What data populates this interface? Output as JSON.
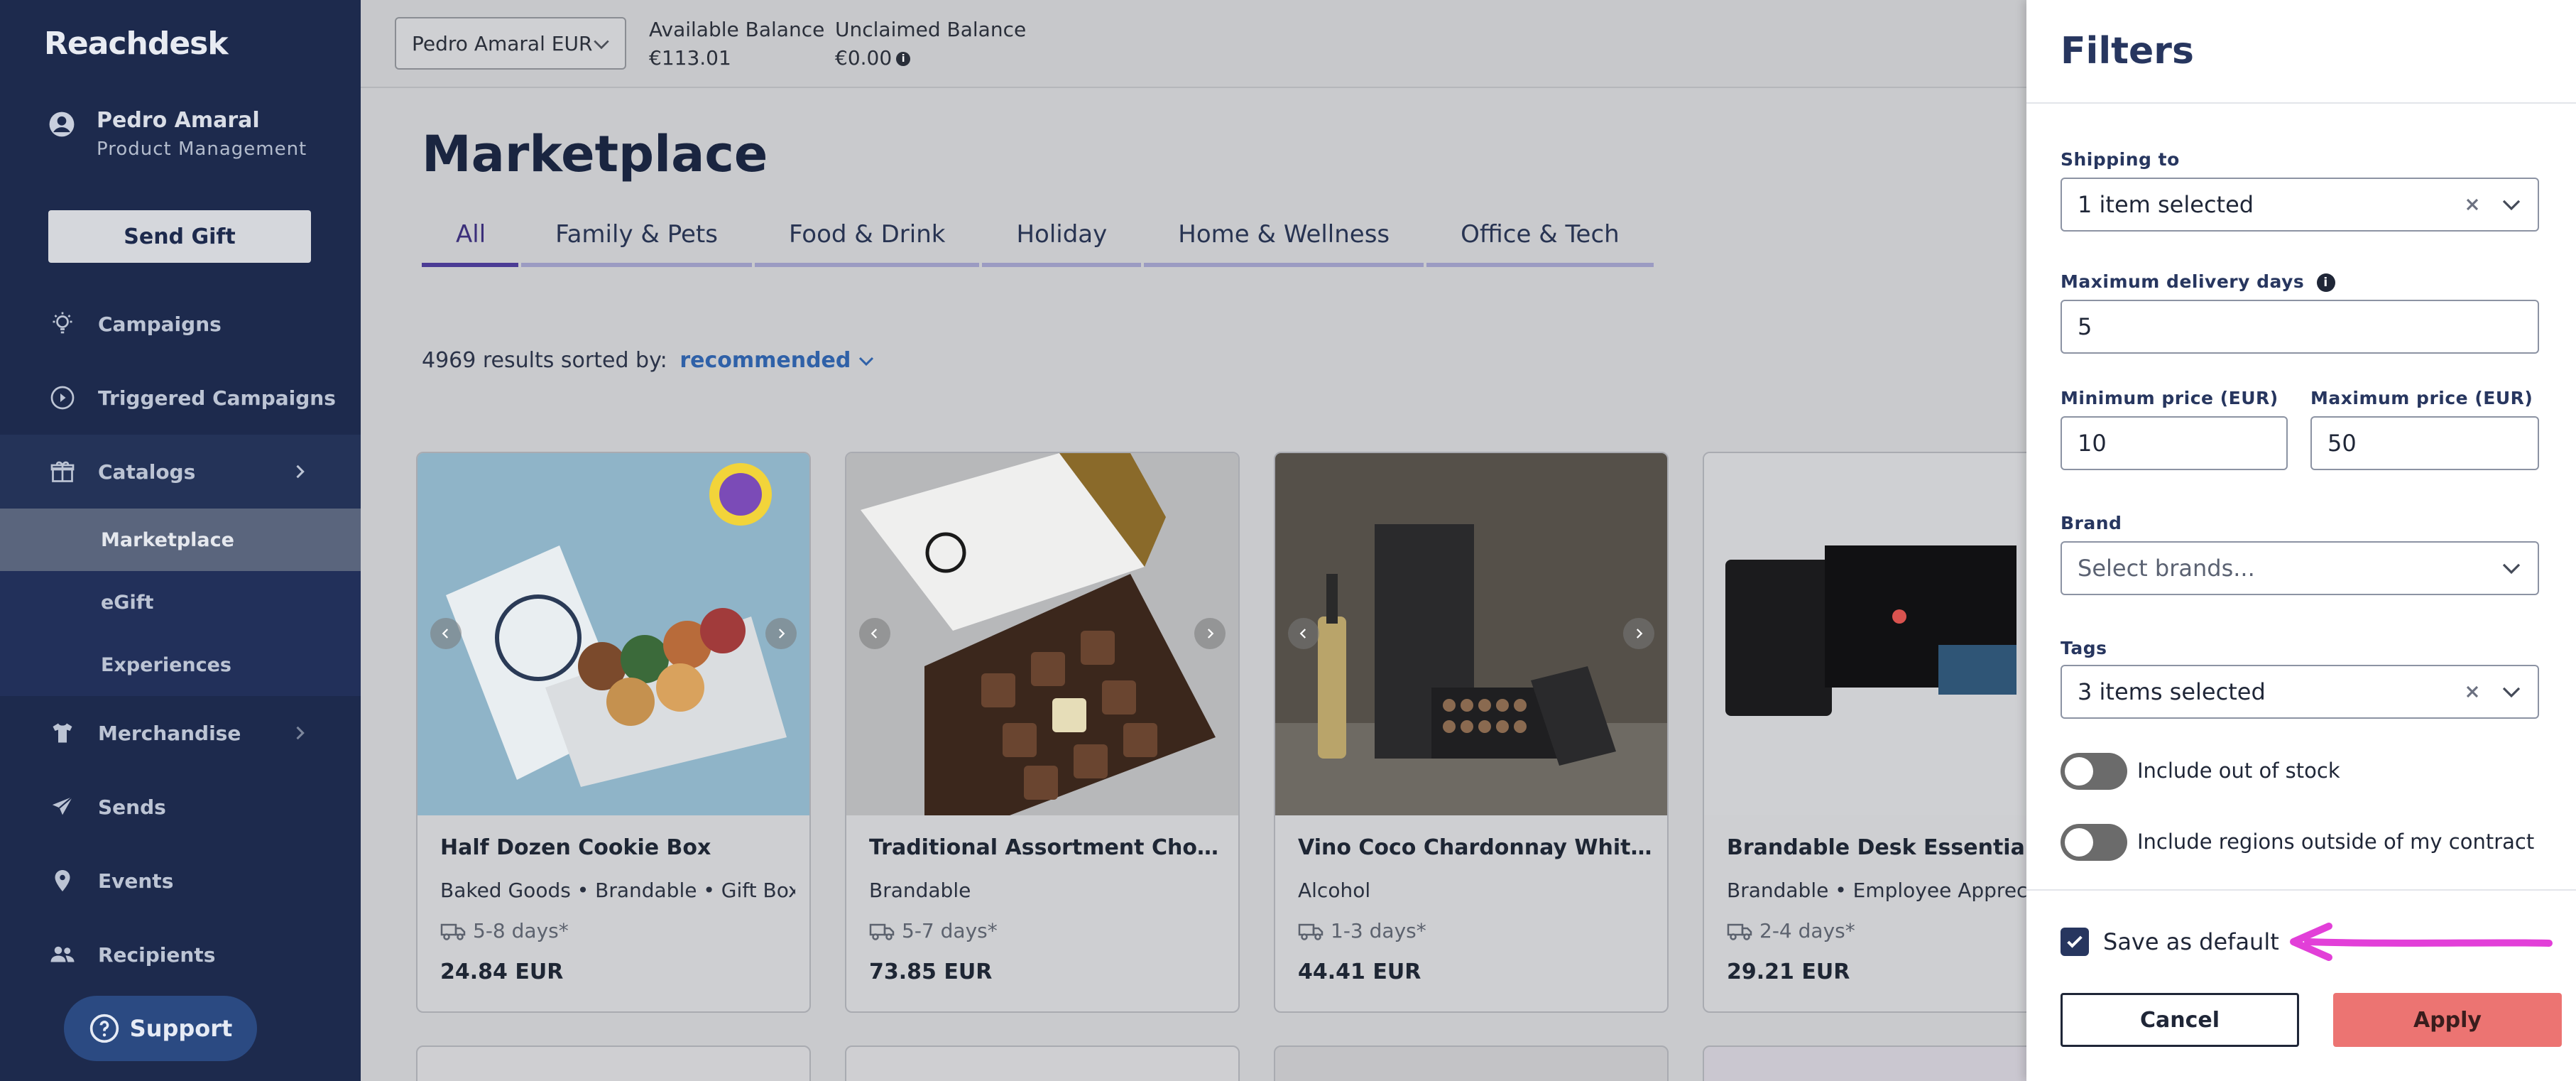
{
  "app": {
    "logo": "Reachdesk"
  },
  "user": {
    "name": "Pedro Amaral",
    "role": "Product Management"
  },
  "sidebar": {
    "send_gift": "Send Gift",
    "items": [
      {
        "label": "Campaigns",
        "icon": "lightbulb-icon"
      },
      {
        "label": "Triggered Campaigns",
        "icon": "play-circle-icon"
      },
      {
        "label": "Catalogs",
        "icon": "gift-icon"
      },
      {
        "label": "Merchandise",
        "icon": "tshirt-icon"
      },
      {
        "label": "Sends",
        "icon": "paper-plane-icon"
      },
      {
        "label": "Events",
        "icon": "map-pin-icon"
      },
      {
        "label": "Recipients",
        "icon": "people-icon"
      }
    ],
    "catalog_sub": [
      "Marketplace",
      "eGift",
      "Experiences"
    ],
    "support": "Support"
  },
  "topbar": {
    "account": "Pedro Amaral EUR",
    "available_label": "Available Balance",
    "available_value": "€113.01",
    "unclaimed_label": "Unclaimed Balance",
    "unclaimed_value": "€0.00"
  },
  "main": {
    "title": "Marketplace",
    "tabs": [
      "All",
      "Family & Pets",
      "Food & Drink",
      "Holiday",
      "Home & Wellness",
      "Office & Tech"
    ],
    "results_text": "4969 results sorted by:",
    "sort_value": "recommended",
    "products": [
      {
        "title": "Half Dozen Cookie Box",
        "categories": "Baked Goods • Brandable • Gift Box",
        "days": "5-8 days*",
        "price": "24.84 EUR"
      },
      {
        "title": "Traditional Assortment Chocolat...",
        "categories": "Brandable",
        "days": "5-7 days*",
        "price": "73.85 EUR"
      },
      {
        "title": "Vino Coco Chardonnay White Wi...",
        "categories": "Alcohol",
        "days": "1-3 days*",
        "price": "44.41 EUR"
      },
      {
        "title": "Brandable Desk Essentials + P",
        "categories": "Brandable • Employee Appreciati",
        "days": "2-4 days*",
        "price": "29.21 EUR"
      }
    ]
  },
  "filters": {
    "title": "Filters",
    "shipping_label": "Shipping to",
    "shipping_value": "1 item selected",
    "max_days_label": "Maximum delivery days",
    "max_days_value": "5",
    "min_price_label": "Minimum price (EUR)",
    "min_price_value": "10",
    "max_price_label": "Maximum price (EUR)",
    "max_price_value": "50",
    "brand_label": "Brand",
    "brand_placeholder": "Select brands...",
    "tags_label": "Tags",
    "tags_value": "3 items selected",
    "out_of_stock_label": "Include out of stock",
    "out_of_stock_on": false,
    "regions_label": "Include regions outside of my contract",
    "regions_on": false,
    "save_default_label": "Save as default",
    "save_default_checked": true,
    "cancel": "Cancel",
    "apply": "Apply"
  },
  "colors": {
    "sidebar_bg": "#1d2a4d",
    "accent_navy": "#27365f",
    "apply_red": "#ec7472",
    "annotation_magenta": "#e23fd8"
  }
}
